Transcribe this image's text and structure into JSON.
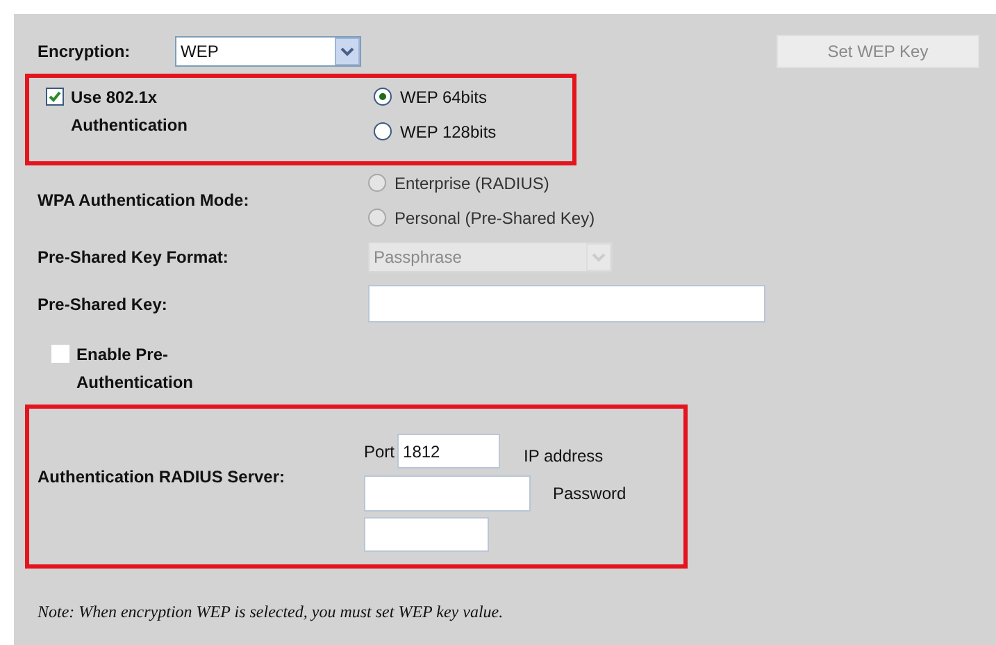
{
  "encryption": {
    "label": "Encryption:",
    "value": "WEP"
  },
  "set_wep_key_button": {
    "label": "Set WEP Key",
    "disabled": true
  },
  "use_8021x": {
    "label": "Use 802.1x Authentication",
    "checked": true
  },
  "wep_key_length": [
    {
      "label": "WEP 64bits",
      "selected": true
    },
    {
      "label": "WEP 128bits",
      "selected": false
    }
  ],
  "wpa_mode": {
    "label": "WPA Authentication Mode:",
    "options": [
      {
        "label": "Enterprise (RADIUS)",
        "selected": false,
        "disabled": true
      },
      {
        "label": "Personal (Pre-Shared Key)",
        "selected": false,
        "disabled": true
      }
    ]
  },
  "psk_format": {
    "label": "Pre-Shared Key Format:",
    "value": "Passphrase",
    "disabled": true
  },
  "psk": {
    "label": "Pre-Shared Key:"
  },
  "pre_auth": {
    "label": "Enable Pre-Authentication",
    "checked": false
  },
  "radius": {
    "label": "Authentication RADIUS Server:",
    "port_label": "Port",
    "port": "1812",
    "ip_label": "IP address",
    "password_label": "Password"
  },
  "note": "Note: When encryption WEP is selected, you must set WEP key value."
}
